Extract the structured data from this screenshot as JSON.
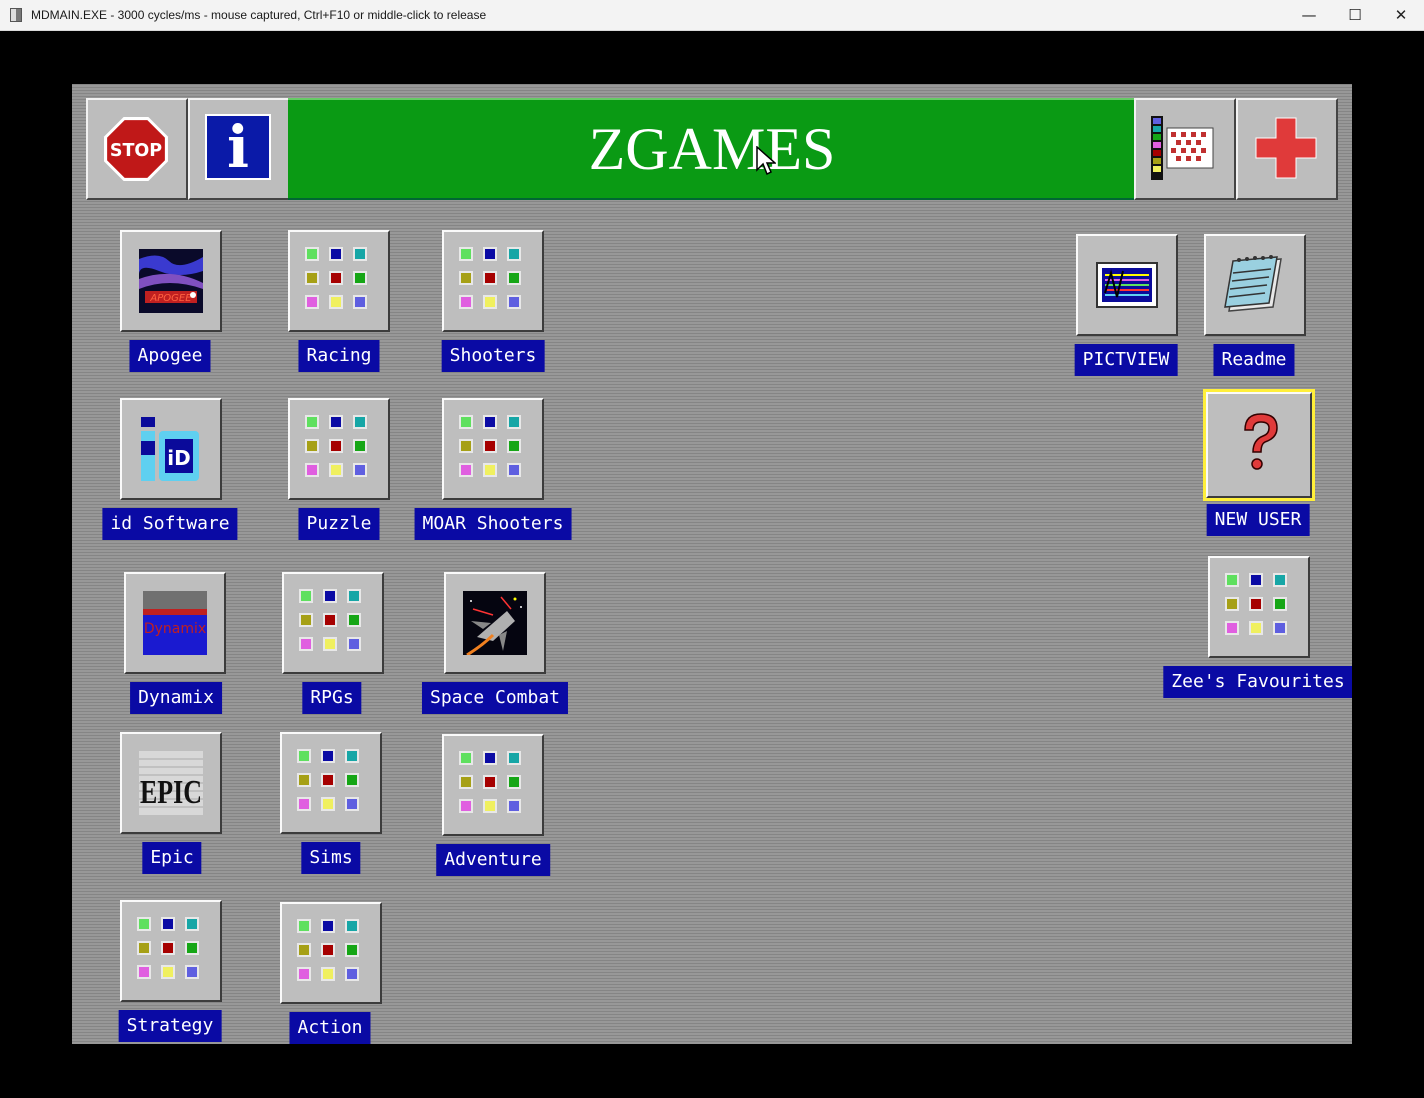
{
  "window": {
    "title": "MDMAIN.EXE - 3000 cycles/ms - mouse captured, Ctrl+F10 or middle-click to release",
    "minimize_glyph": "—",
    "maximize_glyph": "☐",
    "close_glyph": "✕"
  },
  "toolbar": {
    "stop_label": "STOP",
    "info_glyph": "i",
    "title": "ZGAMES"
  },
  "group_colors": [
    "#5fe05f",
    "#0a0aa4",
    "#16a6a6",
    "#a6a016",
    "#a60000",
    "#16a616",
    "#e05fe0",
    "#f0f05f",
    "#5f5fe0"
  ],
  "items": {
    "apogee": "Apogee",
    "racing": "Racing",
    "shooters": "Shooters",
    "id_software": "id Software",
    "puzzle": "Puzzle",
    "moar_shooters": "MOAR Shooters",
    "dynamix": "Dynamix",
    "rpgs": "RPGs",
    "space_combat": "Space Combat",
    "epic": "Epic",
    "sims": "Sims",
    "adventure": "Adventure",
    "strategy": "Strategy",
    "action": "Action",
    "pictview": "PICTVIEW",
    "readme": "Readme",
    "new_user": "NEW USER",
    "zees_favourites": "Zee's Favourites"
  },
  "logo_text": {
    "apogee": "APOGEE",
    "id": "iD",
    "dynamix": "Dynamix",
    "epic": "EPIC"
  }
}
